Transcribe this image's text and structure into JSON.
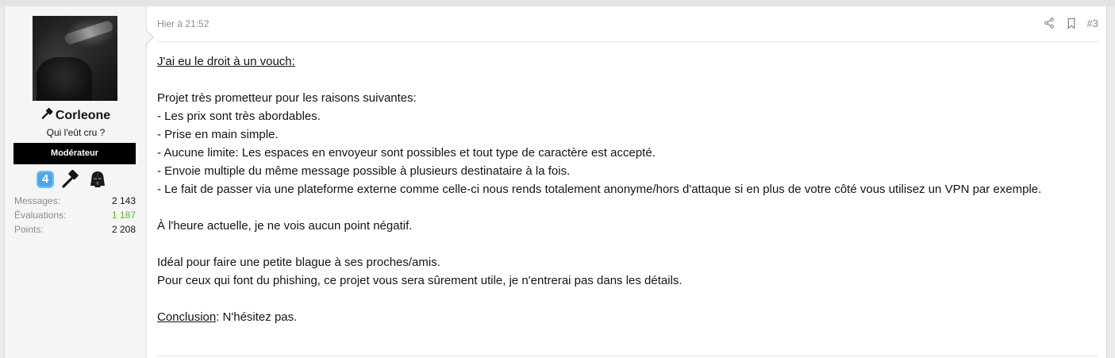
{
  "user": {
    "username": "Corleone",
    "title": "Qui l'eût cru ?",
    "role": "Modérateur",
    "badges": [
      {
        "icon": "badge-4-icon",
        "label": "4"
      },
      {
        "icon": "hammer-icon"
      },
      {
        "icon": "darth-vader-icon"
      }
    ],
    "stats": [
      {
        "label": "Messages:",
        "value": "2 143"
      },
      {
        "label": "Évaluations:",
        "value": "1 187",
        "color": "#63b32e"
      },
      {
        "label": "Points:",
        "value": "2 208"
      }
    ]
  },
  "post": {
    "date": "Hier à 21:52",
    "number": "#3",
    "actions": [
      "share-icon",
      "bookmark-icon"
    ],
    "heading": "J'ai eu le droit à un vouch:",
    "intro": "Projet très prometteur pour les raisons suivantes:",
    "bullets": [
      "- Les prix sont très abordables.",
      "- Prise en main simple.",
      "- Aucune limite: Les espaces en envoyeur sont possibles et tout type de caractère est accepté.",
      "- Envoie multiple du même message possible à plusieurs destinataire à la fois.",
      "- Le fait de passer via une plateforme externe comme celle-ci nous rends totalement anonyme/hors d'attaque si en plus de votre côté vous utilisez un VPN par exemple."
    ],
    "current": "À l'heure actuelle, je ne vois aucun point négatif.",
    "ideal_1": "Idéal pour faire une petite blague à ses proches/amis.",
    "ideal_2": "Pour ceux qui font du phishing, ce projet vous sera sûrement utile, je n'entrerai pas dans les détails.",
    "conclusion_label": "Conclusion",
    "conclusion_text": ": N'hésitez pas."
  },
  "colors": {
    "accent_green": "#63b32e",
    "role_bg": "#000000",
    "badge_blue": "#4ba8e8"
  }
}
